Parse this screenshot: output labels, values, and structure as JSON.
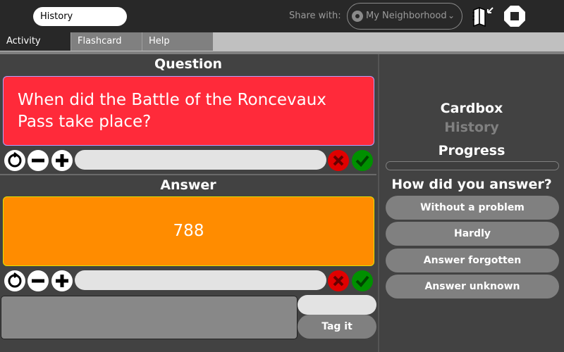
{
  "toolbar": {
    "activity_title": "History",
    "share_label": "Share with:",
    "share_value": "My Neighborhood",
    "icons": [
      "neighborhood-icon",
      "chevron-down-icon",
      "journal-icon",
      "stop-icon"
    ]
  },
  "tabs": [
    {
      "label": "Activity",
      "active": true
    },
    {
      "label": "Flashcard",
      "active": false
    },
    {
      "label": "Help",
      "active": false
    }
  ],
  "question": {
    "heading": "Question",
    "text": "When did the Battle of the Roncevaux Pass take place?",
    "color": "#ff2a3a",
    "controls": [
      "reset-icon",
      "minus-icon",
      "plus-icon",
      "wrong-icon",
      "correct-icon"
    ],
    "input_value": ""
  },
  "answer": {
    "heading": "Answer",
    "text": "788",
    "color": "#ff8c00",
    "controls": [
      "reset-icon",
      "minus-icon",
      "plus-icon",
      "wrong-icon",
      "correct-icon"
    ],
    "input_value": ""
  },
  "tagging": {
    "tags_text": "",
    "tag_input_value": "",
    "tag_button_label": "Tag it"
  },
  "sidebar": {
    "cardbox_label": "Cardbox",
    "cardbox_name": "History",
    "progress_label": "Progress",
    "progress_percent": 0,
    "prompt": "How did you answer?",
    "answer_buttons": [
      "Without a problem",
      "Hardly",
      "Answer forgotten",
      "Answer unknown"
    ]
  },
  "colors": {
    "wrong": "#e00000",
    "correct": "#009000"
  }
}
